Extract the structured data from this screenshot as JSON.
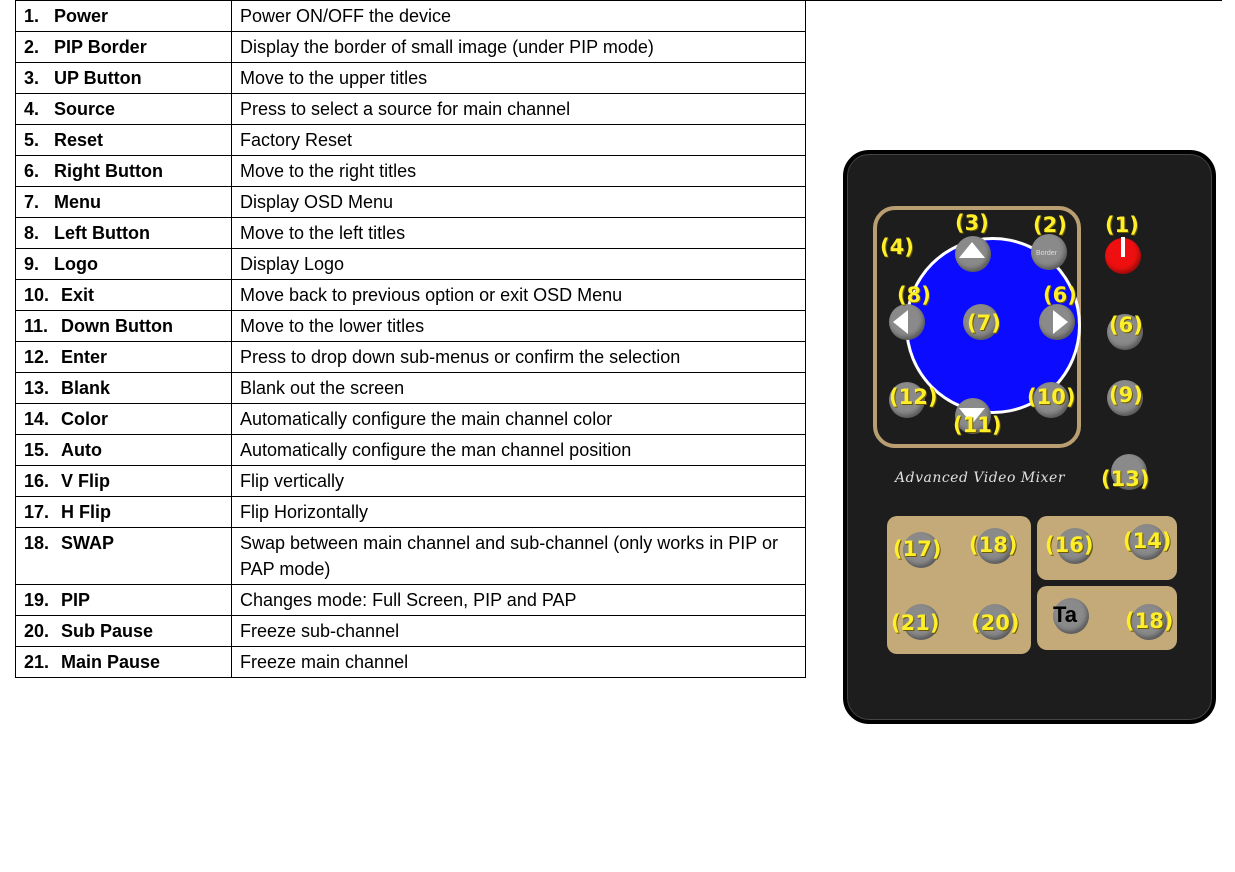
{
  "rows": [
    {
      "num": "1.",
      "name": "Power",
      "desc": "Power ON/OFF the device"
    },
    {
      "num": "2.",
      "name": "PIP Border",
      "desc": "Display the border of small image (under PIP mode)"
    },
    {
      "num": "3.",
      "name": "UP Button",
      "desc": "Move to the upper titles"
    },
    {
      "num": "4.",
      "name": "Source",
      "desc": "Press to select a source for main channel"
    },
    {
      "num": "5.",
      "name": "Reset",
      "desc": "Factory Reset"
    },
    {
      "num": "6.",
      "name": "Right Button",
      "desc": "Move to the right titles"
    },
    {
      "num": "7.",
      "name": "Menu",
      "desc": "Display OSD Menu"
    },
    {
      "num": "8.",
      "name": "Left Button",
      "desc": "Move to the left titles"
    },
    {
      "num": "9.",
      "name": "Logo",
      "desc": "Display Logo"
    },
    {
      "num": "10.",
      "name": "Exit",
      "desc": "Move back to previous option or exit OSD Menu"
    },
    {
      "num": "11.",
      "name": "Down Button",
      "desc": "Move to the lower titles"
    },
    {
      "num": "12.",
      "name": "Enter",
      "desc": "Press to drop down sub-menus or confirm the selection"
    },
    {
      "num": "13.",
      "name": "Blank",
      "desc": "Blank out the screen"
    },
    {
      "num": "14.",
      "name": "Color",
      "desc": "Automatically configure the main channel color"
    },
    {
      "num": "15.",
      "name": "Auto",
      "desc": "Automatically configure the man channel position"
    },
    {
      "num": "16.",
      "name": "V Flip",
      "desc": "Flip vertically"
    },
    {
      "num": "17.",
      "name": "H Flip",
      "desc": "Flip Horizontally"
    },
    {
      "num": "18.",
      "name": "SWAP",
      "desc": "Swap between main channel and sub-channel (only works in PIP or PAP mode)"
    },
    {
      "num": "19.",
      "name": "PIP",
      "desc": "Changes mode: Full Screen, PIP and PAP"
    },
    {
      "num": "20.",
      "name": "Sub Pause",
      "desc": "Freeze sub-channel"
    },
    {
      "num": "21.",
      "name": "Main Pause",
      "desc": "Freeze main channel"
    }
  ],
  "remote": {
    "caption": "Advanced Video Mixer",
    "ta_label": "Ta",
    "border_label": "Border",
    "callouts": {
      "c1": "(1)",
      "c2": "(2)",
      "c3": "(3)",
      "c4": "(4)",
      "c6": "(6)",
      "c7": "(7)",
      "c8": "(8)",
      "c9": "(9)",
      "c10": "(10)",
      "c11": "(11)",
      "c12": "(12)",
      "c13": "(13)",
      "c14": "(14)",
      "c16": "(16)",
      "c17": "(17)",
      "c18a": "(18)",
      "c18b": "(18)",
      "c20": "(20)",
      "c21": "(21)",
      "c5": "(6)"
    }
  },
  "colors": {
    "key_text": "#8b0000",
    "remote_body": "#1d1d1d",
    "pad_blue": "#0b0bff",
    "callout_yellow": "#ffef2a",
    "block_tan": "#c4aa78",
    "power_red": "#ee1010"
  }
}
